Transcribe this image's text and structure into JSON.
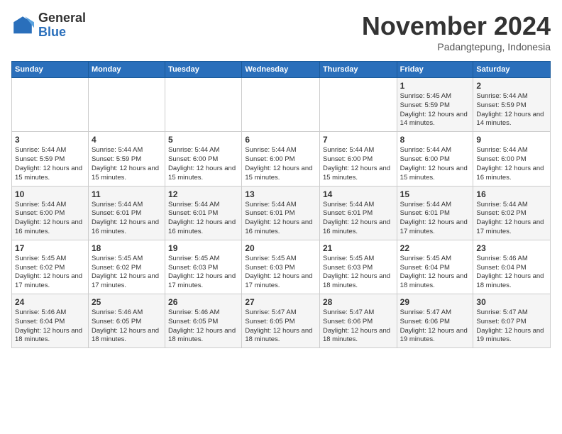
{
  "logo": {
    "general": "General",
    "blue": "Blue"
  },
  "title": "November 2024",
  "subtitle": "Padangtepung, Indonesia",
  "days_of_week": [
    "Sunday",
    "Monday",
    "Tuesday",
    "Wednesday",
    "Thursday",
    "Friday",
    "Saturday"
  ],
  "weeks": [
    [
      {
        "day": "",
        "info": ""
      },
      {
        "day": "",
        "info": ""
      },
      {
        "day": "",
        "info": ""
      },
      {
        "day": "",
        "info": ""
      },
      {
        "day": "",
        "info": ""
      },
      {
        "day": "1",
        "info": "Sunrise: 5:45 AM\nSunset: 5:59 PM\nDaylight: 12 hours and 14 minutes."
      },
      {
        "day": "2",
        "info": "Sunrise: 5:44 AM\nSunset: 5:59 PM\nDaylight: 12 hours and 14 minutes."
      }
    ],
    [
      {
        "day": "3",
        "info": "Sunrise: 5:44 AM\nSunset: 5:59 PM\nDaylight: 12 hours and 15 minutes."
      },
      {
        "day": "4",
        "info": "Sunrise: 5:44 AM\nSunset: 5:59 PM\nDaylight: 12 hours and 15 minutes."
      },
      {
        "day": "5",
        "info": "Sunrise: 5:44 AM\nSunset: 6:00 PM\nDaylight: 12 hours and 15 minutes."
      },
      {
        "day": "6",
        "info": "Sunrise: 5:44 AM\nSunset: 6:00 PM\nDaylight: 12 hours and 15 minutes."
      },
      {
        "day": "7",
        "info": "Sunrise: 5:44 AM\nSunset: 6:00 PM\nDaylight: 12 hours and 15 minutes."
      },
      {
        "day": "8",
        "info": "Sunrise: 5:44 AM\nSunset: 6:00 PM\nDaylight: 12 hours and 15 minutes."
      },
      {
        "day": "9",
        "info": "Sunrise: 5:44 AM\nSunset: 6:00 PM\nDaylight: 12 hours and 16 minutes."
      }
    ],
    [
      {
        "day": "10",
        "info": "Sunrise: 5:44 AM\nSunset: 6:00 PM\nDaylight: 12 hours and 16 minutes."
      },
      {
        "day": "11",
        "info": "Sunrise: 5:44 AM\nSunset: 6:01 PM\nDaylight: 12 hours and 16 minutes."
      },
      {
        "day": "12",
        "info": "Sunrise: 5:44 AM\nSunset: 6:01 PM\nDaylight: 12 hours and 16 minutes."
      },
      {
        "day": "13",
        "info": "Sunrise: 5:44 AM\nSunset: 6:01 PM\nDaylight: 12 hours and 16 minutes."
      },
      {
        "day": "14",
        "info": "Sunrise: 5:44 AM\nSunset: 6:01 PM\nDaylight: 12 hours and 16 minutes."
      },
      {
        "day": "15",
        "info": "Sunrise: 5:44 AM\nSunset: 6:01 PM\nDaylight: 12 hours and 17 minutes."
      },
      {
        "day": "16",
        "info": "Sunrise: 5:44 AM\nSunset: 6:02 PM\nDaylight: 12 hours and 17 minutes."
      }
    ],
    [
      {
        "day": "17",
        "info": "Sunrise: 5:45 AM\nSunset: 6:02 PM\nDaylight: 12 hours and 17 minutes."
      },
      {
        "day": "18",
        "info": "Sunrise: 5:45 AM\nSunset: 6:02 PM\nDaylight: 12 hours and 17 minutes."
      },
      {
        "day": "19",
        "info": "Sunrise: 5:45 AM\nSunset: 6:03 PM\nDaylight: 12 hours and 17 minutes."
      },
      {
        "day": "20",
        "info": "Sunrise: 5:45 AM\nSunset: 6:03 PM\nDaylight: 12 hours and 17 minutes."
      },
      {
        "day": "21",
        "info": "Sunrise: 5:45 AM\nSunset: 6:03 PM\nDaylight: 12 hours and 18 minutes."
      },
      {
        "day": "22",
        "info": "Sunrise: 5:45 AM\nSunset: 6:04 PM\nDaylight: 12 hours and 18 minutes."
      },
      {
        "day": "23",
        "info": "Sunrise: 5:46 AM\nSunset: 6:04 PM\nDaylight: 12 hours and 18 minutes."
      }
    ],
    [
      {
        "day": "24",
        "info": "Sunrise: 5:46 AM\nSunset: 6:04 PM\nDaylight: 12 hours and 18 minutes."
      },
      {
        "day": "25",
        "info": "Sunrise: 5:46 AM\nSunset: 6:05 PM\nDaylight: 12 hours and 18 minutes."
      },
      {
        "day": "26",
        "info": "Sunrise: 5:46 AM\nSunset: 6:05 PM\nDaylight: 12 hours and 18 minutes."
      },
      {
        "day": "27",
        "info": "Sunrise: 5:47 AM\nSunset: 6:05 PM\nDaylight: 12 hours and 18 minutes."
      },
      {
        "day": "28",
        "info": "Sunrise: 5:47 AM\nSunset: 6:06 PM\nDaylight: 12 hours and 18 minutes."
      },
      {
        "day": "29",
        "info": "Sunrise: 5:47 AM\nSunset: 6:06 PM\nDaylight: 12 hours and 19 minutes."
      },
      {
        "day": "30",
        "info": "Sunrise: 5:47 AM\nSunset: 6:07 PM\nDaylight: 12 hours and 19 minutes."
      }
    ]
  ]
}
